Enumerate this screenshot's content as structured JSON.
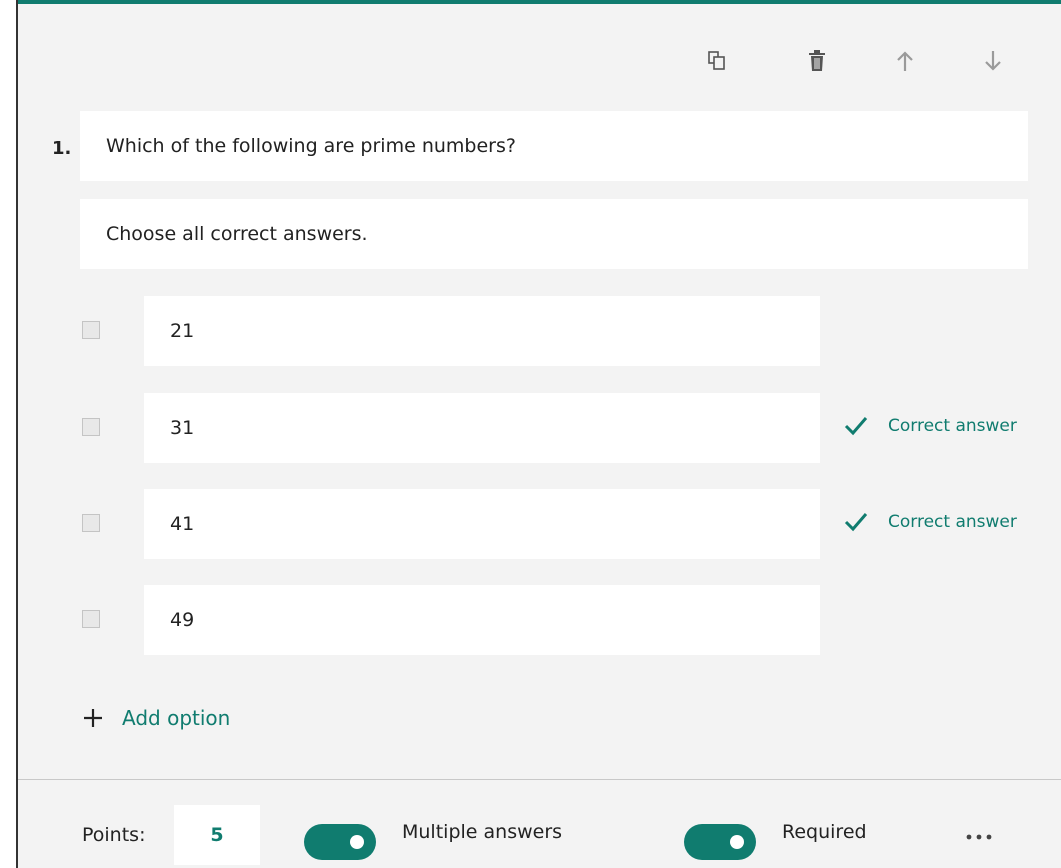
{
  "colors": {
    "accent": "#107c6f",
    "card_background": "#f3f3f3",
    "field_background": "#ffffff"
  },
  "toolbar": {
    "icons": [
      "copy-icon",
      "delete-icon",
      "arrow-up-icon",
      "arrow-down-icon"
    ]
  },
  "question": {
    "number": "1.",
    "title": "Which of the following are prime numbers?",
    "subtitle": "Choose all correct answers.",
    "options": [
      {
        "label": "21",
        "correct": false
      },
      {
        "label": "31",
        "correct": true
      },
      {
        "label": "41",
        "correct": true
      },
      {
        "label": "49",
        "correct": false
      }
    ],
    "correct_label": "Correct answer",
    "add_option_label": "Add option"
  },
  "footer": {
    "points_label": "Points:",
    "points_value": "5",
    "multiple_answers_label": "Multiple answers",
    "multiple_answers_on": true,
    "required_label": "Required",
    "required_on": true,
    "more_icon": "more-icon"
  }
}
